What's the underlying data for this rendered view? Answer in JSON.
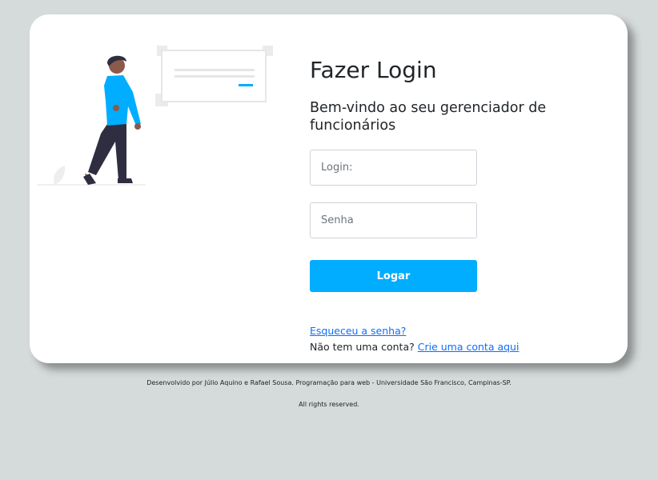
{
  "login": {
    "title": "Fazer Login",
    "subtitle": "Bem-vindo ao seu gerenciador de funcionários",
    "login_placeholder": "Login:",
    "password_placeholder": "Senha",
    "submit_label": "Logar",
    "forgot_password": "Esqueceu a senha?",
    "no_account": "Não tem uma conta?",
    "create_account": "Crie uma conta aqui"
  },
  "footer": {
    "credits": "Desenvolvido por Júlio Aquino e Rafael Sousa. Programação para web - Universidade São Francisco, Campinas-SP.",
    "rights": "All rights reserved."
  },
  "colors": {
    "accent": "#00adff",
    "background": "#d5dadb",
    "link": "#0d6efd"
  }
}
